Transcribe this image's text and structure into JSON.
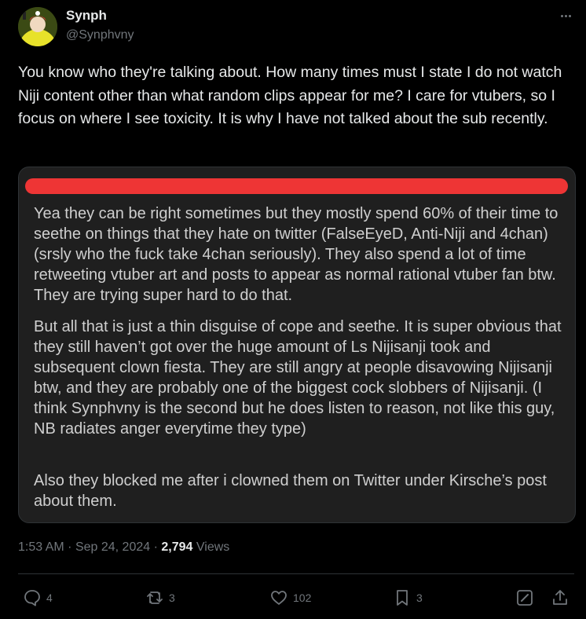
{
  "author": {
    "name": "Synph",
    "handle": "@Synphvny"
  },
  "tweet": {
    "text": "You know who they're talking about. How many times must I state I do not watch Niji content other than what random clips appear for me? I care for vtubers, so I focus on where I see toxicity. It is why I have not talked about the sub recently."
  },
  "media": {
    "redaction_color": "#ee3535",
    "paragraphs": [
      "Yea they can be right sometimes but they mostly spend 60% of their time to seethe on things that they hate on twitter (FalseEyeD, Anti-Niji and 4chan) (srsly who the fuck take 4chan seriously). They also spend a lot of time retweeting vtuber art and posts to appear as normal rational vtuber fan btw. They are trying super hard to do that.",
      "But all that is just a thin disguise of cope and seethe. It is super obvious that they still haven’t got over the huge amount of Ls Nijisanji took and subsequent clown fiesta. They are still angry at people disavowing Nijisanji btw, and they are probably one of the biggest cock slobbers of Nijisanji. (I think Synphvny is the second but he does listen to reason, not like this guy, NB radiates anger everytime they type)",
      "Also they blocked me after i clowned them on Twitter under Kirsche’s post about them."
    ]
  },
  "meta": {
    "time": "1:53 AM",
    "date": "Sep 24, 2024",
    "views_count": "2,794",
    "views_label": "Views"
  },
  "actions": {
    "replies": "4",
    "reposts": "3",
    "likes": "102",
    "bookmarks": "3"
  },
  "icons": [
    "more-icon",
    "reply-icon",
    "repost-icon",
    "like-icon",
    "bookmark-icon",
    "grok-icon",
    "share-icon"
  ]
}
